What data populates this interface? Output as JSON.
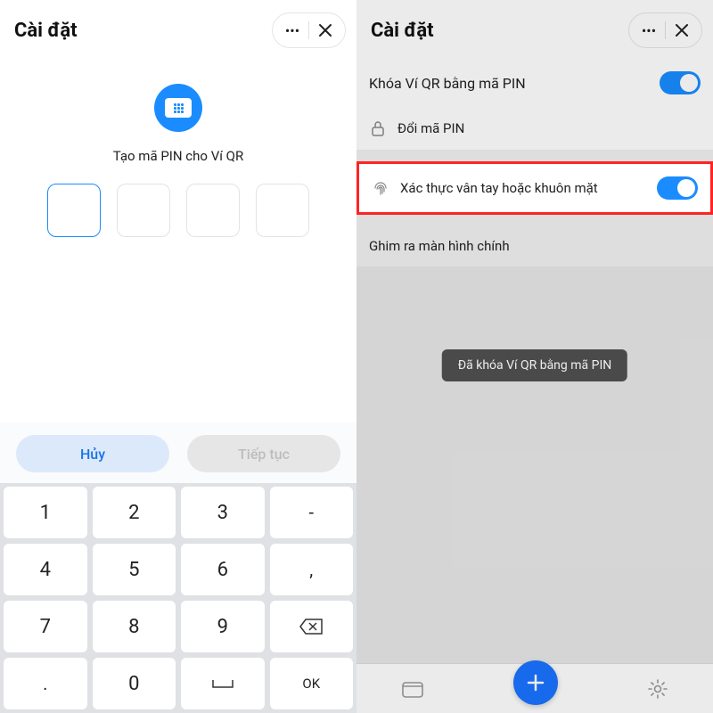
{
  "left": {
    "header": {
      "title": "Cài đặt"
    },
    "pin": {
      "prompt": "Tạo mã PIN cho Ví QR"
    },
    "buttons": {
      "cancel": "Hủy",
      "continue": "Tiếp tục"
    },
    "keypad": {
      "k1": "1",
      "k2": "2",
      "k3": "3",
      "dash": "-",
      "k4": "4",
      "k5": "5",
      "k6": "6",
      "comma": ",",
      "k7": "7",
      "k8": "8",
      "k9": "9",
      "dot": ".",
      "k0": "0",
      "ok": "OK"
    }
  },
  "right": {
    "header": {
      "title": "Cài đặt"
    },
    "rows": {
      "lockPin": "Khóa Ví QR bằng mã PIN",
      "changePin": "Đổi mã PIN",
      "biometric": "Xác thực vân tay hoặc khuôn mặt",
      "pinHome": "Ghim ra màn hình chính"
    },
    "toast": "Đã khóa Ví QR bằng mã PIN"
  }
}
